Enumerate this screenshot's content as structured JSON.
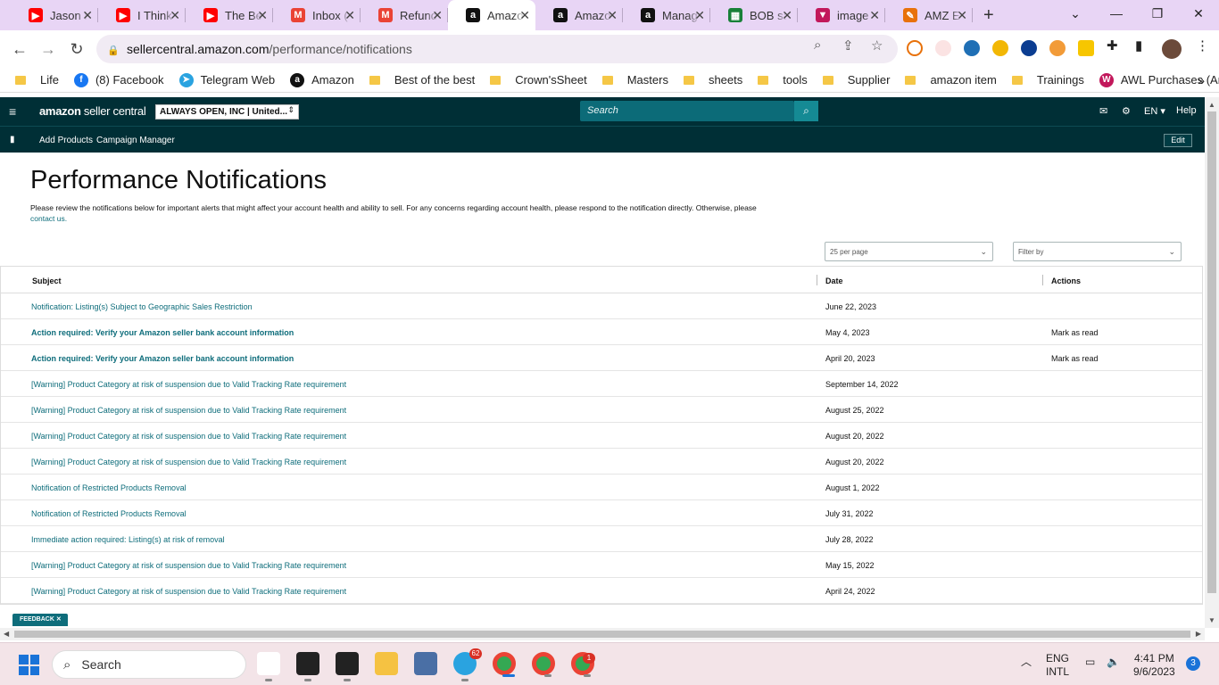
{
  "browser": {
    "tabs": [
      {
        "title": "Jason I",
        "icon": "youtube-icon",
        "color": "#ff0000"
      },
      {
        "title": "I Think",
        "icon": "youtube-icon",
        "color": "#ff0000"
      },
      {
        "title": "The Be",
        "icon": "youtube-icon",
        "color": "#ff0000"
      },
      {
        "title": "Inbox (",
        "icon": "gmail-icon",
        "color": "#ea4335"
      },
      {
        "title": "Refund",
        "icon": "gmail-icon",
        "color": "#ea4335"
      },
      {
        "title": "Amazo",
        "icon": "amazon-icon",
        "color": "#111111",
        "active": true
      },
      {
        "title": "Amazo",
        "icon": "amazon-icon",
        "color": "#111111"
      },
      {
        "title": "Manag",
        "icon": "amazon-icon",
        "color": "#111111"
      },
      {
        "title": "BOB sa",
        "icon": "sheets-icon",
        "color": "#188038"
      },
      {
        "title": "image",
        "icon": "brand-icon",
        "color": "#c2185b"
      },
      {
        "title": "AMZ E",
        "icon": "pen-icon",
        "color": "#e8710a"
      }
    ],
    "url_domain": "sellercentral.amazon.com",
    "url_path": "/performance/notifications",
    "bookmarks": [
      {
        "label": "Life",
        "type": "folder"
      },
      {
        "label": "(8) Facebook",
        "type": "facebook"
      },
      {
        "label": "Telegram Web",
        "type": "telegram"
      },
      {
        "label": "Amazon",
        "type": "amazon"
      },
      {
        "label": "Best of the best",
        "type": "folder"
      },
      {
        "label": "Crown'sSheet",
        "type": "folder"
      },
      {
        "label": "Masters",
        "type": "folder"
      },
      {
        "label": "sheets",
        "type": "folder"
      },
      {
        "label": "tools",
        "type": "folder"
      },
      {
        "label": "Supplier",
        "type": "folder"
      },
      {
        "label": "amazon item",
        "type": "folder"
      },
      {
        "label": "Trainings",
        "type": "folder"
      },
      {
        "label": "AWL Purchases (Am...",
        "type": "awl"
      }
    ]
  },
  "header": {
    "logo_main": "amazon",
    "logo_sub": " seller central",
    "store": "ALWAYS OPEN, INC | United...",
    "search_placeholder": "Search",
    "language": "EN",
    "help": "Help",
    "nav_links": [
      "Add Products",
      "Campaign Manager"
    ],
    "edit": "Edit"
  },
  "main": {
    "title": "Performance Notifications",
    "description": "Please review the notifications below for important alerts that might affect your account health and ability to sell. For any concerns regarding account health, please respond to the notification directly. Otherwise, please",
    "contact_link": "contact us.",
    "per_page": "25 per page",
    "filter": "Filter by",
    "columns": {
      "subject": "Subject",
      "date": "Date",
      "actions": "Actions"
    },
    "rows": [
      {
        "subject": "Notification: Listing(s) Subject to Geographic Sales Restriction",
        "date": "June 22, 2023",
        "action": "",
        "bold": false
      },
      {
        "subject": "Action required: Verify your Amazon seller bank account information",
        "date": "May 4, 2023",
        "action": "Mark as read",
        "bold": true
      },
      {
        "subject": "Action required: Verify your Amazon seller bank account information",
        "date": "April 20, 2023",
        "action": "Mark as read",
        "bold": true
      },
      {
        "subject": "[Warning] Product Category at risk of suspension due to Valid Tracking Rate requirement",
        "date": "September 14, 2022",
        "action": "",
        "bold": false
      },
      {
        "subject": "[Warning] Product Category at risk of suspension due to Valid Tracking Rate requirement",
        "date": "August 25, 2022",
        "action": "",
        "bold": false
      },
      {
        "subject": "[Warning] Product Category at risk of suspension due to Valid Tracking Rate requirement",
        "date": "August 20, 2022",
        "action": "",
        "bold": false
      },
      {
        "subject": "[Warning] Product Category at risk of suspension due to Valid Tracking Rate requirement",
        "date": "August 20, 2022",
        "action": "",
        "bold": false
      },
      {
        "subject": "Notification of Restricted Products Removal",
        "date": "August 1, 2022",
        "action": "",
        "bold": false
      },
      {
        "subject": "Notification of Restricted Products Removal",
        "date": "July 31, 2022",
        "action": "",
        "bold": false
      },
      {
        "subject": "Immediate action required: Listing(s) at risk of removal",
        "date": "July 28, 2022",
        "action": "",
        "bold": false
      },
      {
        "subject": "[Warning] Product Category at risk of suspension due to Valid Tracking Rate requirement",
        "date": "May 15, 2022",
        "action": "",
        "bold": false
      },
      {
        "subject": "[Warning] Product Category at risk of suspension due to Valid Tracking Rate requirement",
        "date": "April 24, 2022",
        "action": "",
        "bold": false
      }
    ],
    "feedback": "FEEDBACK"
  },
  "taskbar": {
    "search": "Search",
    "telegram_badge": "62",
    "chrome_badge": "1",
    "lang_top": "ENG",
    "lang_bottom": "INTL",
    "time": "4:41 PM",
    "date": "9/6/2023",
    "notif_count": "3"
  },
  "colors": {
    "header_bg": "#002f36",
    "link": "#0e6d7b",
    "search_bg": "#0c6b78"
  }
}
